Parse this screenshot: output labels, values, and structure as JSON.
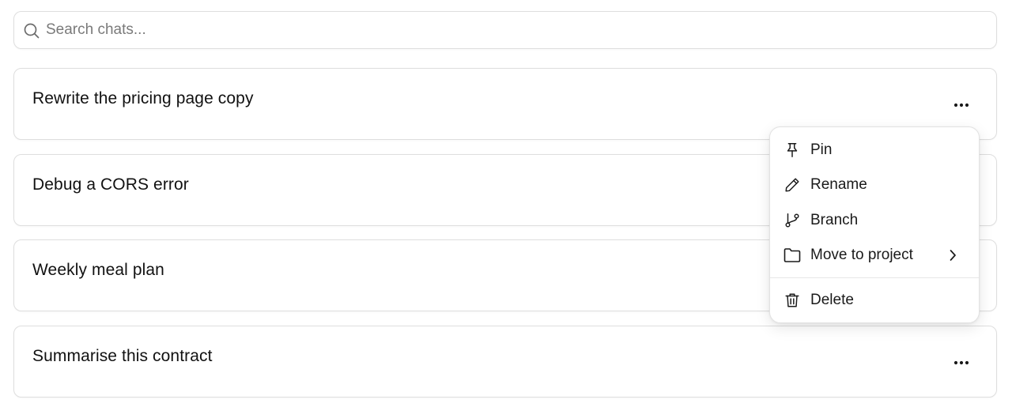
{
  "search": {
    "placeholder": "Search chats..."
  },
  "chats": [
    {
      "title": "Rewrite the pricing page copy",
      "has_menu_button": true
    },
    {
      "title": "Debug a CORS error",
      "has_menu_button": false
    },
    {
      "title": "Weekly meal plan",
      "has_menu_button": false
    },
    {
      "title": "Summarise this contract",
      "has_menu_button": true
    }
  ],
  "context_menu": {
    "items": [
      {
        "label": "Pin",
        "icon": "pin-icon"
      },
      {
        "label": "Rename",
        "icon": "pencil-icon"
      },
      {
        "label": "Branch",
        "icon": "branch-icon"
      },
      {
        "label": "Move to project",
        "icon": "folder-icon",
        "submenu": true
      },
      {
        "label": "Delete",
        "icon": "trash-icon"
      }
    ]
  }
}
